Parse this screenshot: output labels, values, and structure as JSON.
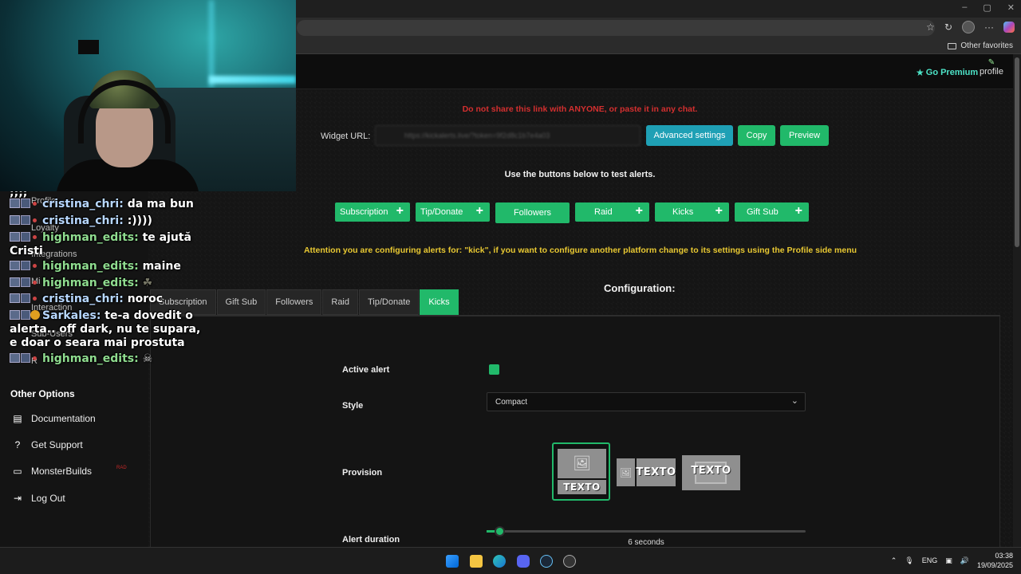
{
  "browser": {
    "favorites_label": "Other favorites",
    "window_controls": [
      "–",
      "▢",
      "✕"
    ],
    "toolbar_icons": [
      "star-icon",
      "refresh-icon",
      "profile-avatar",
      "more-icon",
      "copilot-icon"
    ]
  },
  "header": {
    "premium_label": "Go Premium",
    "profile_label": "profile"
  },
  "widget": {
    "warning": "Do not share this link with ANYONE, or paste it in any chat.",
    "url_label": "Widget URL:",
    "url_value": "https://kickalerts.live/?token=9f2d8c1b7e4a03",
    "advanced_label": "Advanced settings",
    "copy_label": "Copy",
    "preview_label": "Preview"
  },
  "test": {
    "instructions": "Use the buttons below to test alerts.",
    "buttons": [
      "Subscription",
      "Tip/Donate",
      "Followers",
      "Raid",
      "Kicks",
      "Gift Sub"
    ]
  },
  "attention": "Attention you are configuring alerts for: \"kick\", if you want to configure another platform change to its settings using the Profile side menu",
  "tabs": {
    "items": [
      "Subscription",
      "Gift Sub",
      "Followers",
      "Raid",
      "Tip/Donate",
      "Kicks"
    ],
    "active": "Kicks"
  },
  "config": {
    "title": "Configuration:",
    "active_label": "Active alert",
    "active_value": true,
    "style_label": "Style",
    "style_value": "Compact",
    "provision_label": "Provision",
    "provision_text": "TEXTO",
    "duration_label": "Alert duration",
    "duration_value": "6 seconds",
    "duration_seconds": 6
  },
  "sidebar": {
    "ghost_items": [
      "Profile",
      "Loyalty",
      "Integrations",
      "Mi",
      "Interaction",
      "Sub-Users",
      "R"
    ],
    "heading": "Other Options",
    "items": [
      {
        "label": "Documentation",
        "icon": "book-icon"
      },
      {
        "label": "Get Support",
        "icon": "question-icon"
      },
      {
        "label": "MonsterBuilds",
        "icon": "laptop-icon"
      },
      {
        "label": "Log Out",
        "icon": "logout-icon"
      }
    ],
    "badge": "RAD"
  },
  "chat": [
    {
      "user": "",
      "text": ";;;;"
    },
    {
      "user": "cristina_chri:",
      "text": "da ma bun"
    },
    {
      "user": "cristina_chri:",
      "text": ":))))"
    },
    {
      "user": "highman_edits:",
      "text": "te ajută"
    },
    {
      "user": "",
      "text": "Cristi"
    },
    {
      "user": "highman_edits:",
      "text": "maine"
    },
    {
      "user": "highman_edits:",
      "text": ""
    },
    {
      "user": "cristina_chri:",
      "text": "noroc"
    },
    {
      "user": "Sarkales:",
      "text": "te-a dovedit o"
    },
    {
      "user": "",
      "text": "alerta.. off dark, nu te supara,"
    },
    {
      "user": "",
      "text": "e doar o seara mai prostuta"
    },
    {
      "user": "highman_edits:",
      "text": ""
    }
  ],
  "taskbar": {
    "lang": "ENG",
    "time": "03:38",
    "date": "19/09/2025"
  },
  "colors": {
    "accent_green": "#21b96a",
    "accent_teal": "#1fa0b5",
    "warning_red": "#d32f2f",
    "attention_yellow": "#e8c832",
    "premium_cyan": "#4de3c7"
  }
}
